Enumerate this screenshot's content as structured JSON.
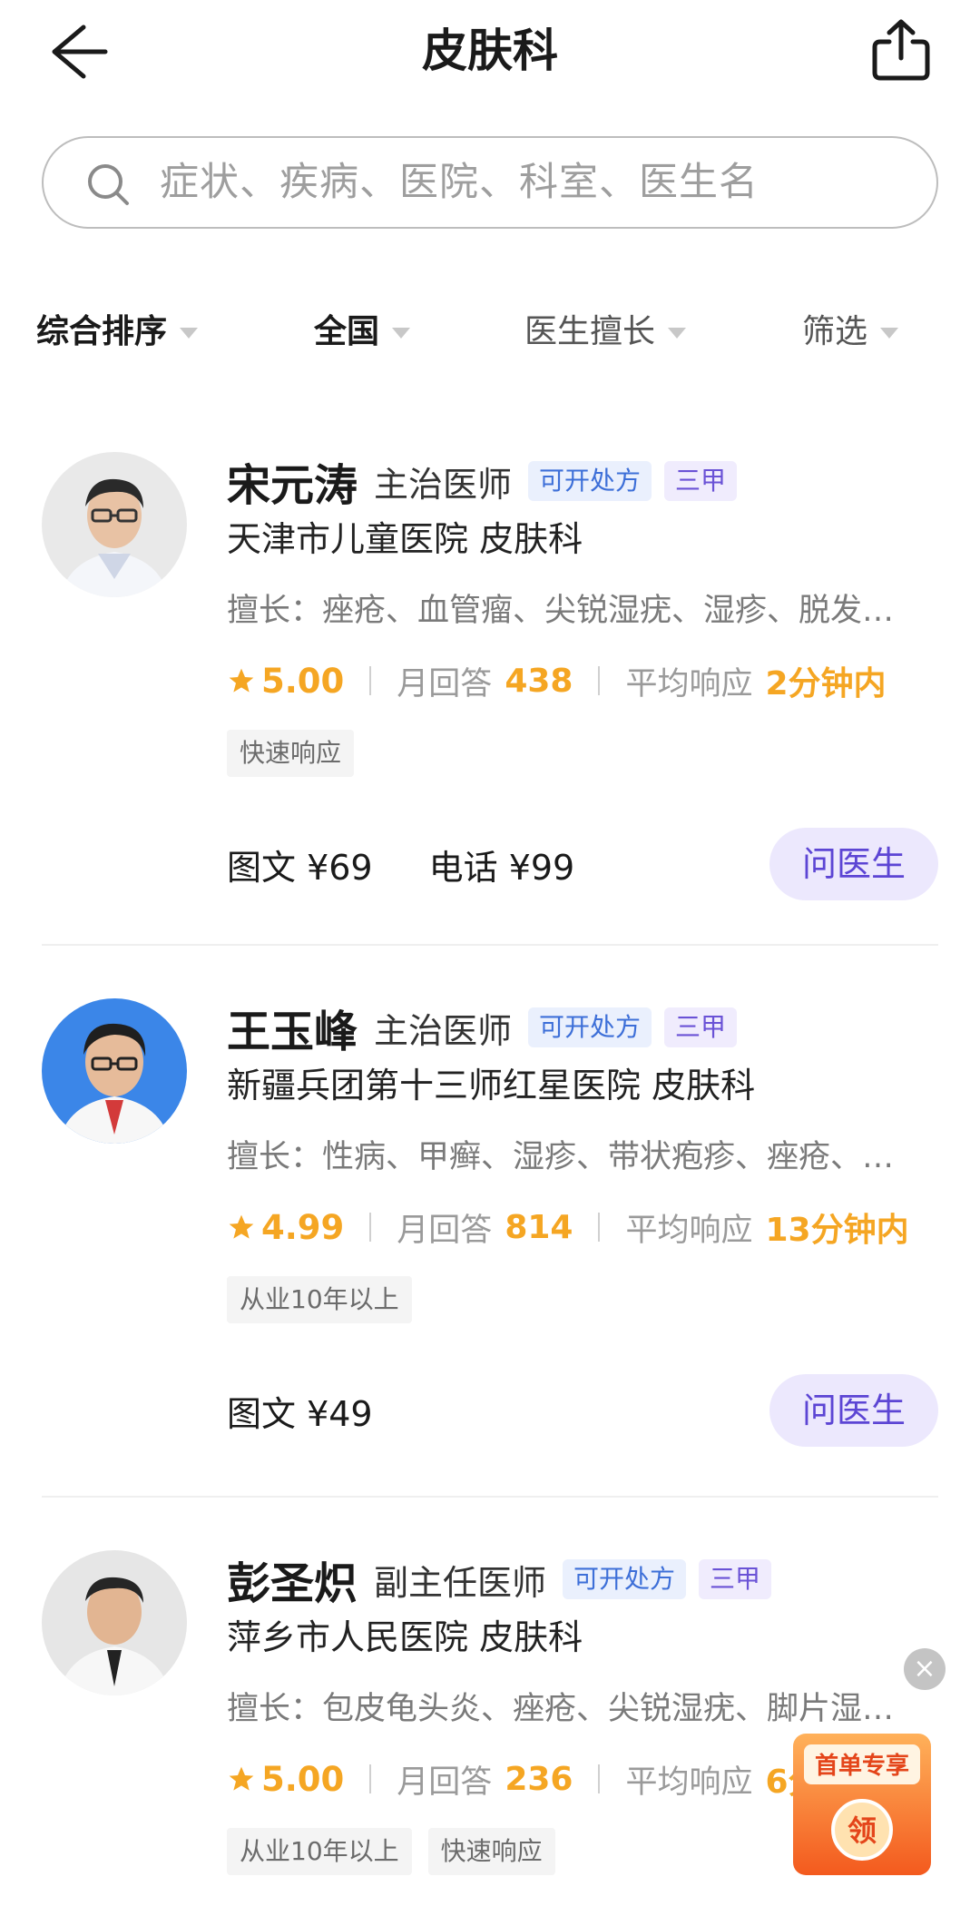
{
  "header": {
    "title": "皮肤科",
    "back_icon": "arrow-left-icon",
    "share_icon": "share-icon"
  },
  "search": {
    "placeholder": "症状、疾病、医院、科室、医生名",
    "icon": "search-icon"
  },
  "filters": [
    {
      "label": "综合排序",
      "active": true
    },
    {
      "label": "全国",
      "active": true
    },
    {
      "label": "医生擅长",
      "active": false
    },
    {
      "label": "筛选",
      "active": false
    }
  ],
  "doctors": [
    {
      "name": "宋元涛",
      "title": "主治医师",
      "rx_badge": "可开处方",
      "grade_badge": "三甲",
      "hospital": "天津市儿童医院  皮肤科",
      "specialty": "擅长：痤疮、血管瘤、尖锐湿疣、湿疹、脱发…",
      "rating": "5.00",
      "monthly_label": "月回答",
      "monthly_value": "438",
      "response_label": "平均响应",
      "response_value": "2分钟内",
      "tags": [
        "快速响应"
      ],
      "prices": [
        "图文 ¥69",
        "电话 ¥99"
      ],
      "ask_label": "问医生"
    },
    {
      "name": "王玉峰",
      "title": "主治医师",
      "rx_badge": "可开处方",
      "grade_badge": "三甲",
      "hospital": "新疆兵团第十三师红星医院  皮肤科",
      "specialty": "擅长：性病、甲癣、湿疹、带状疱疹、痤疮、…",
      "rating": "4.99",
      "monthly_label": "月回答",
      "monthly_value": "814",
      "response_label": "平均响应",
      "response_value": "13分钟内",
      "tags": [
        "从业10年以上"
      ],
      "prices": [
        "图文 ¥49"
      ],
      "ask_label": "问医生"
    },
    {
      "name": "彭圣炽",
      "title": "副主任医师",
      "rx_badge": "可开处方",
      "grade_badge": "三甲",
      "hospital": "萍乡市人民医院  皮肤科",
      "specialty": "擅长：包皮龟头炎、痤疮、尖锐湿疣、脚片湿…",
      "rating": "5.00",
      "monthly_label": "月回答",
      "monthly_value": "236",
      "response_label": "平均响应",
      "response_value": "6分钟内",
      "tags": [
        "从业10年以上",
        "快速响应"
      ]
    }
  ],
  "promo": {
    "title": "首单专享",
    "coin": "领",
    "close": "×"
  },
  "colors": {
    "accent_orange": "#f5a623",
    "button_bg": "#ece8fd",
    "button_text": "#5c45d4"
  }
}
